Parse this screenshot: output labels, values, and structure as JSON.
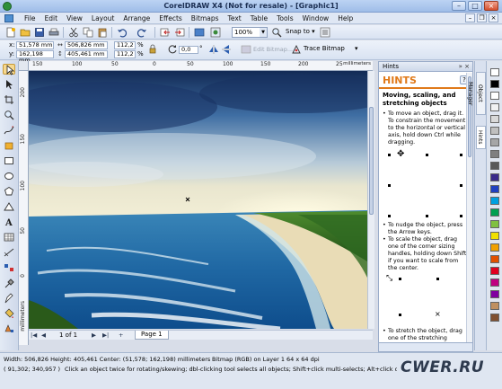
{
  "window": {
    "title": "CorelDRAW X4 (Not for resale) - [Graphic1]"
  },
  "menu": [
    "File",
    "Edit",
    "View",
    "Layout",
    "Arrange",
    "Effects",
    "Bitmaps",
    "Text",
    "Table",
    "Tools",
    "Window",
    "Help"
  ],
  "toolbar": {
    "zoom": "100%",
    "snap": "Snap to"
  },
  "propbar": {
    "x_label": "x:",
    "x_value": "51,578 mm",
    "y_label": "y:",
    "y_value": "162,198 mm",
    "w_value": "506,826 mm",
    "h_value": "405,461 mm",
    "scale_x": "112,2",
    "scale_y": "112,2",
    "percent": "%",
    "angle": "0,0",
    "angle_unit": "°",
    "edit_bitmap": "Edit Bitmap...",
    "trace_bitmap": "Trace Bitmap"
  },
  "rulers": {
    "top": [
      "150",
      "100",
      "50",
      "0",
      "50",
      "100",
      "150",
      "200",
      "250"
    ],
    "units": "millimeters",
    "left": [
      "200",
      "150",
      "100",
      "50",
      "0"
    ],
    "left_units": "millimeters"
  },
  "pagenav": {
    "count": "1 of 1",
    "tab": "Page 1"
  },
  "hints": {
    "docker_title": "Hints",
    "title": "HINTS",
    "heading": "Moving, scaling, and stretching objects",
    "items": [
      "To move an object, drag it. To constrain the movement to the horizontal or vertical axis, hold down Ctrl while dragging.",
      "To nudge the object, press the Arrow keys.",
      "To scale the object, drag one of the corner sizing handles, holding down Shift if you want to scale from the center.",
      "To stretch the object, drag one of the stretching"
    ]
  },
  "docker_tabs": [
    "Object Manager",
    "Hints"
  ],
  "palette": [
    "#ffffff",
    "#000000",
    "#ffffff",
    "#f2f2f2",
    "#d9d9d9",
    "#bfbfbf",
    "#a6a6a6",
    "#808080",
    "#595959",
    "#3a2a8a",
    "#2040c0",
    "#00a0e0",
    "#00a050",
    "#80c040",
    "#f0e000",
    "#f0a000",
    "#e05000",
    "#e00020",
    "#c00080",
    "#8000a0",
    "#c09060",
    "#805030"
  ],
  "status": {
    "line1": "Width: 506,826  Height: 405,461  Center: (51,578; 162,198)  millimeters",
    "line1_right": "Bitmap (RGB) on Layer 1 64 x 64 dpi",
    "line2": "( 91,302; 340,957 )",
    "line2_right": "Click an object twice for rotating/skewing; dbl-clicking tool selects all objects; Shift+click multi-selects; Alt+click digs; Ctrl+cli..."
  },
  "watermark": "CWER.RU"
}
